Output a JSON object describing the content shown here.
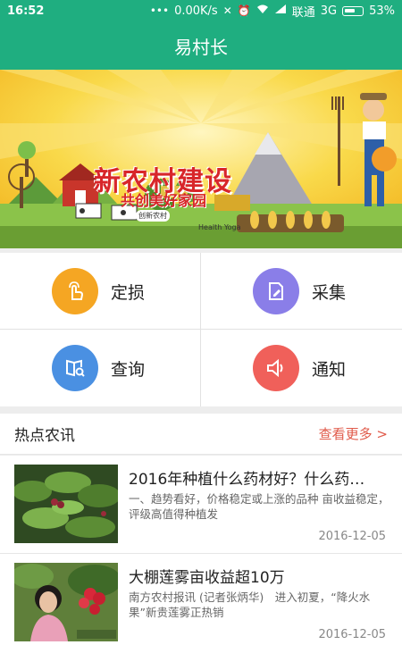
{
  "status": {
    "time": "16:52",
    "net_speed": "0.00K/s",
    "carrier": "联通",
    "network": "3G",
    "battery": "53%"
  },
  "app": {
    "title": "易村长"
  },
  "banner": {
    "headline": "新农村建设",
    "subline": "共创美好家园",
    "logo_text": "创新农村",
    "brand_text": "Health Yoga",
    "active_slide": 1,
    "slide_count": 3
  },
  "grid": {
    "items": [
      {
        "label": "定损",
        "icon": "touch-hand-icon",
        "color": "#f5a623"
      },
      {
        "label": "采集",
        "icon": "edit-document-icon",
        "color": "#8a7ee8"
      },
      {
        "label": "查询",
        "icon": "book-search-icon",
        "color": "#4a90e2"
      },
      {
        "label": "通知",
        "icon": "speaker-icon",
        "color": "#f0605a"
      }
    ]
  },
  "news": {
    "section_title": "热点农讯",
    "more_label": "查看更多 >",
    "items": [
      {
        "title": "2016年种植什么药材好？什么药…",
        "desc": "一、趋势看好，价格稳定或上涨的品种 亩收益稳定，评级高值得种植发",
        "date": "2016-12-05"
      },
      {
        "title": "大棚莲雾亩收益超10万",
        "desc": "南方农村报讯 (记者张炳华)　进入初夏，“降火水果”新贵莲雾正热销",
        "date": "2016-12-05"
      }
    ]
  }
}
